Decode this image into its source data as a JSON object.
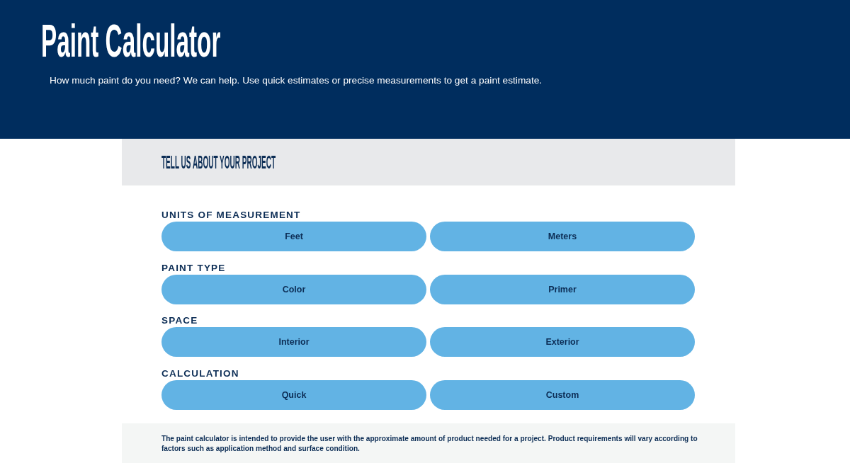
{
  "header": {
    "title": "Paint Calculator",
    "subtitle": "How much paint do you need? We can help. Use quick estimates or precise measurements to get a paint estimate."
  },
  "section_title": "TELL US ABOUT YOUR PROJECT",
  "option_groups": [
    {
      "label": "UNITS OF MEASUREMENT",
      "options": [
        {
          "label": "Feet",
          "selected": false
        },
        {
          "label": "Meters",
          "selected": false
        }
      ]
    },
    {
      "label": "PAINT TYPE",
      "options": [
        {
          "label": "Color",
          "selected": false
        },
        {
          "label": "Primer",
          "selected": false
        }
      ]
    },
    {
      "label": "SPACE",
      "options": [
        {
          "label": "Interior",
          "selected": false
        },
        {
          "label": "Exterior",
          "selected": false
        }
      ]
    },
    {
      "label": "CALCULATION",
      "options": [
        {
          "label": "Quick",
          "selected": false
        },
        {
          "label": "Custom",
          "selected": false
        }
      ]
    }
  ],
  "disclaimer": "The paint calculator is intended to provide the user with the approximate amount of product needed for a project. Product requirements will vary according to factors such as application method and surface condition."
}
